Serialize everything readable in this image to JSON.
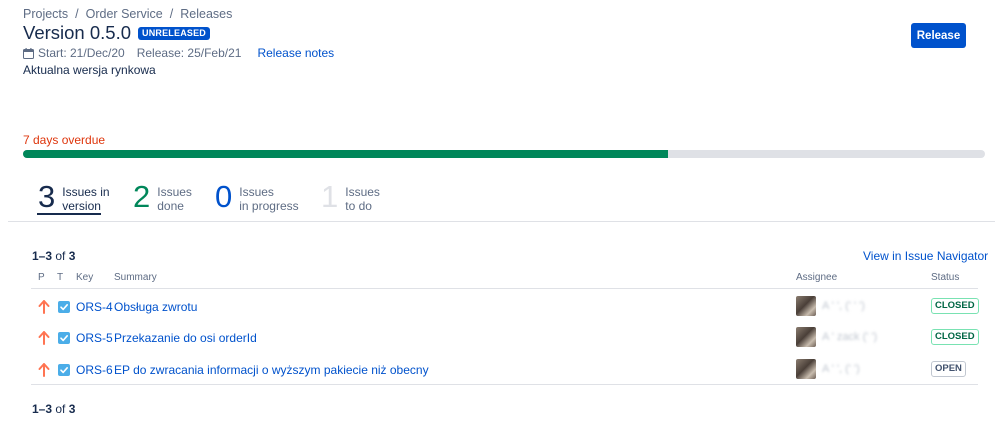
{
  "breadcrumb": {
    "projects": "Projects",
    "project": "Order Service",
    "section": "Releases",
    "separator": "/"
  },
  "version": {
    "title": "Version 0.5.0",
    "badge": "UNRELEASED",
    "start": "Start: 21/Dec/20",
    "release_date": "Release: 25/Feb/21",
    "release_notes": "Release notes",
    "description": "Aktualna wersja rynkowa"
  },
  "actions": {
    "release_label": "Release"
  },
  "progress": {
    "overdue_text": "7 days overdue",
    "done_fraction": 0.67,
    "fill_color": "#00875a"
  },
  "stats": [
    {
      "count": "3",
      "label": "Issues in\nversion"
    },
    {
      "count": "2",
      "label": "Issues\ndone"
    },
    {
      "count": "0",
      "label": "Issues\nin progress"
    },
    {
      "count": "1",
      "label": "Issues\nto do"
    }
  ],
  "issues": {
    "range": "1–3",
    "of": "of",
    "total": "3",
    "navigator_link": "View in Issue Navigator",
    "columns": {
      "p": "P",
      "t": "T",
      "key": "Key",
      "summary": "Summary",
      "assignee": "Assignee",
      "status": "Status"
    },
    "rows": [
      {
        "priority_icon": "arrow-up-icon",
        "type_icon": "task-check-icon",
        "key": "ORS-4",
        "summary": "Obsługa zwrotu",
        "assignee": "A ' ', (' ' ')",
        "status": "CLOSED"
      },
      {
        "priority_icon": "arrow-up-icon",
        "type_icon": "task-check-icon",
        "key": "ORS-5",
        "summary": "Przekazanie do osi orderId",
        "assignee": "A '  zack (' ')",
        "status": "CLOSED"
      },
      {
        "priority_icon": "arrow-up-icon",
        "type_icon": "task-check-icon",
        "key": "ORS-6",
        "summary": "EP do zwracania informacji o wyższym pakiecie niż obecny",
        "assignee": "A ' ', (' ')",
        "status": "OPEN"
      }
    ]
  }
}
